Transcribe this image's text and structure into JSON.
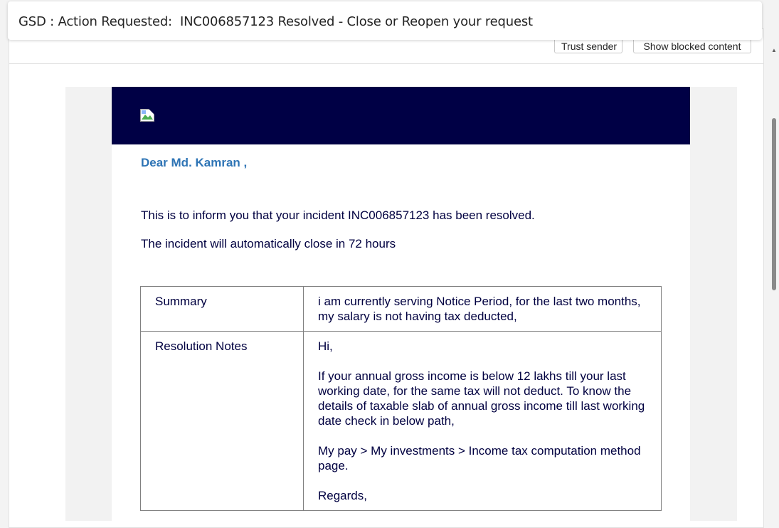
{
  "subject": "GSD : Action Requested:  INC006857123 Resolved - Close or Reopen your request",
  "info_bar": {
    "trust_sender_label": "Trust sender",
    "show_blocked_label": "Show blocked content"
  },
  "email": {
    "greeting": "Dear Md. Kamran ,",
    "paragraph1": "This is to inform you that your incident INC006857123 has been resolved.",
    "paragraph2": "The incident will automatically close in 72 hours",
    "table": {
      "summary_label": "Summary",
      "summary_value": "i am currently serving Notice Period, for the last two months, my salary is not having tax deducted,",
      "notes_label": "Resolution Notes",
      "notes_lines": [
        "Hi,",
        "If your annual gross income is below 12 lakhs till your last working date, for the same tax will not deduct. To know the details of taxable slab of annual gross income till last working date check in below path,",
        "My pay > My investments > Income tax computation method page.",
        "Regards,"
      ]
    }
  },
  "colors": {
    "header_band": "#000045",
    "greeting": "#2e74b5",
    "body_text": "#000040"
  },
  "icons": {
    "broken_image": "broken-image-icon",
    "scroll_up": "scroll-up-arrow-icon"
  }
}
